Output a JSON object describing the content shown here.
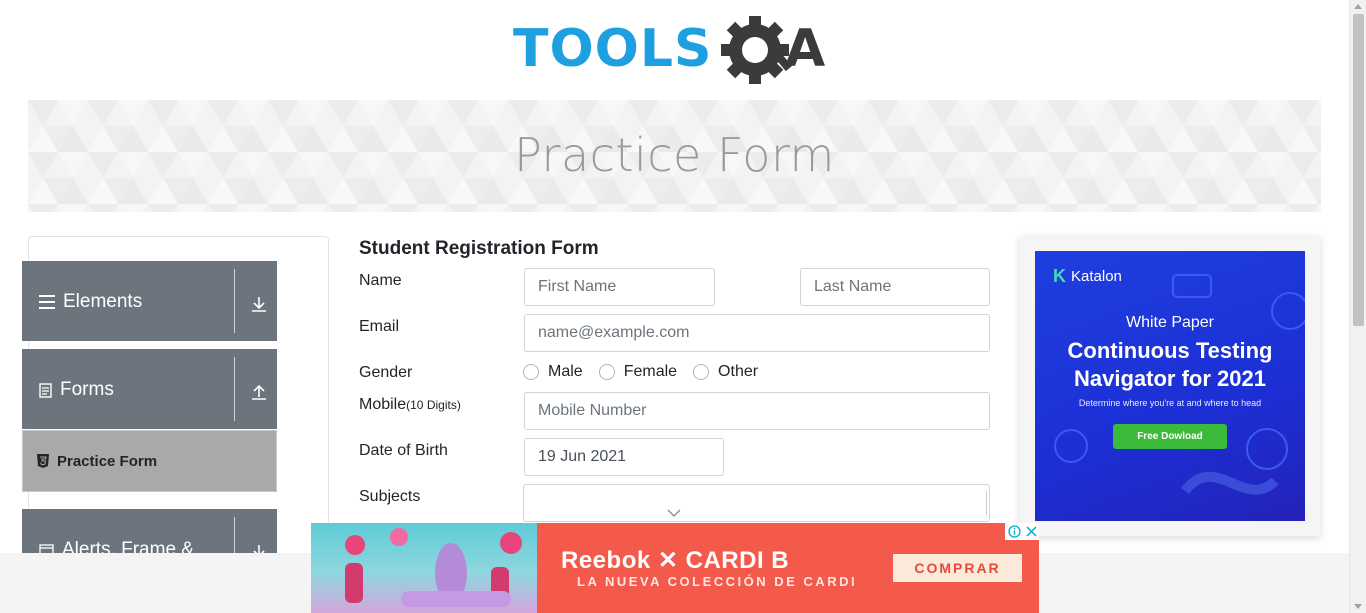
{
  "logo": {
    "text_left": "TOOLS",
    "text_right": "QA",
    "colors": {
      "tools": "#1e9fe0",
      "qa": "#3b3b3b"
    }
  },
  "banner": {
    "title": "Practice Form"
  },
  "sidebar": {
    "groups": [
      {
        "label": "Elements",
        "icon": "hamburger-icon",
        "toggle": "download-arrow-icon"
      },
      {
        "label": "Forms",
        "icon": "document-icon",
        "toggle": "upload-arrow-icon"
      },
      {
        "label": "Alerts, Frame &",
        "icon": "window-icon",
        "toggle": "download-arrow-icon"
      }
    ],
    "active_item": {
      "label": "Practice Form",
      "icon": "html5-icon"
    }
  },
  "form": {
    "title": "Student Registration Form",
    "name_label": "Name",
    "first_name_placeholder": "First Name",
    "last_name_placeholder": "Last Name",
    "email_label": "Email",
    "email_placeholder": "name@example.com",
    "gender_label": "Gender",
    "gender_options": [
      "Male",
      "Female",
      "Other"
    ],
    "mobile_label": "Mobile",
    "mobile_hint": "(10 Digits)",
    "mobile_placeholder": "Mobile Number",
    "dob_label": "Date of Birth",
    "dob_value": "19 Jun 2021",
    "subjects_label": "Subjects"
  },
  "right_ad": {
    "brand": "Katalon",
    "kicker": "White Paper",
    "headline_1": "Continuous Testing",
    "headline_2": "Navigator for 2021",
    "description": "Determine where you're at and where to head",
    "button": "Free Dowload"
  },
  "bottom_ad": {
    "brand_line": "Reebok  ✕  CARDI B",
    "subline": "LA NUEVA COLECCIÓN DE CARDI",
    "cta": "COMPRAR"
  }
}
